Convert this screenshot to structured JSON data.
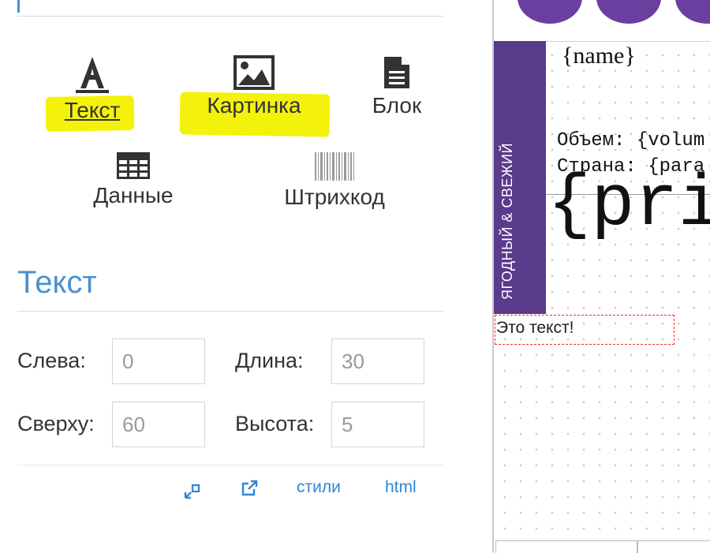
{
  "toolbox": {
    "items": [
      {
        "label": "Текст",
        "icon": "font-icon"
      },
      {
        "label": "Картинка",
        "icon": "image-icon"
      },
      {
        "label": "Блок",
        "icon": "document-icon"
      },
      {
        "label": "Данные",
        "icon": "table-icon"
      },
      {
        "label": "Штрихкод",
        "icon": "barcode-icon"
      }
    ]
  },
  "properties": {
    "title": "Текст",
    "left_label": "Слева:",
    "left_value": "0",
    "width_label": "Длина:",
    "width_value": "30",
    "top_label": "Сверху:",
    "top_value": "60",
    "height_label": "Высота:",
    "height_value": "5",
    "styles_link": "стили",
    "html_link": "html"
  },
  "canvas": {
    "name_text": "{name}",
    "volume_text": "Объем: {volum",
    "country_text": "Страна: {para",
    "price_text": "{pri",
    "vertical_text": "ЯГОДНЫЙ & СВЕЖИЙ",
    "text_element": "Это текст!"
  },
  "colors": {
    "accent": "#4a90cf",
    "link": "#2f86d8",
    "highlight": "#f4f20a",
    "purple": "#5a3b8c",
    "selection": "#e03030"
  }
}
